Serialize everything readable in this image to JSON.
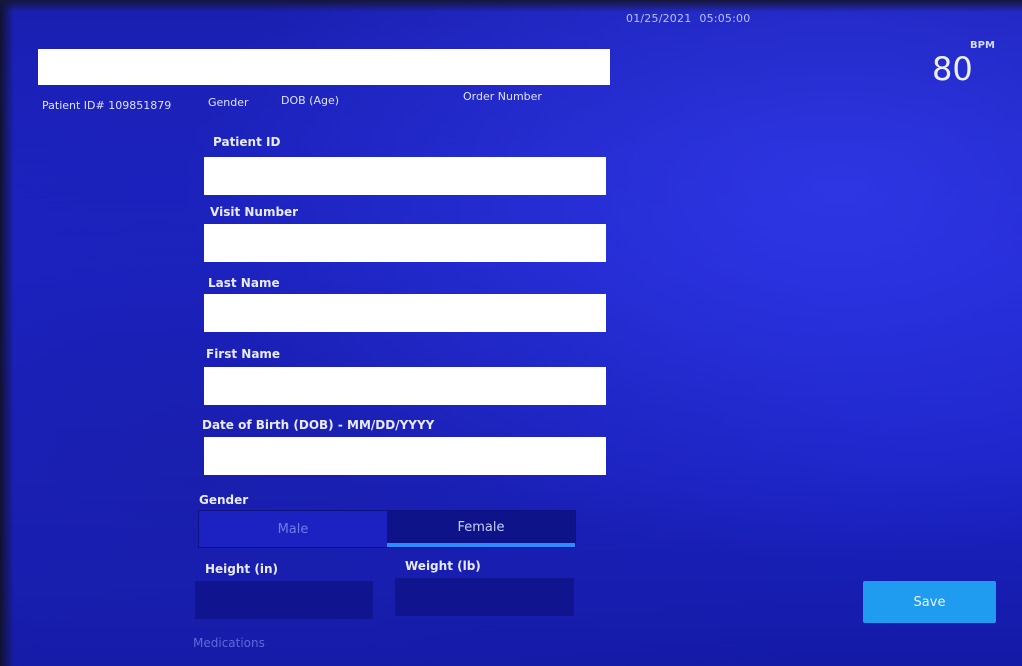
{
  "status_bar": {
    "date": "01/25/2021",
    "time": "05:05:00",
    "bpm_label": "BPM",
    "bpm_value": "80"
  },
  "header": {
    "patient_id": "Patient ID# 109851879",
    "gender": "Gender",
    "dob": "DOB (Age)",
    "order_number": "Order Number"
  },
  "form": {
    "patient_id_label": "Patient ID",
    "visit_number_label": "Visit Number",
    "last_name_label": "Last Name",
    "first_name_label": "First Name",
    "dob_label": "Date of Birth (DOB) - MM/DD/YYYY",
    "gender_label": "Gender",
    "gender_options": [
      "Male",
      "Female"
    ],
    "gender_selected": "Female",
    "height_label": "Height (in)",
    "weight_label": "Weight (lb)",
    "medications_label": "Medications"
  },
  "actions": {
    "save_label": "Save"
  },
  "colors": {
    "background": "#1d24c9",
    "field": "#ffffff",
    "save_button": "#1f9bf0",
    "toggle_selected": "#0f138a",
    "toggle_indicator": "#2a8cff"
  }
}
